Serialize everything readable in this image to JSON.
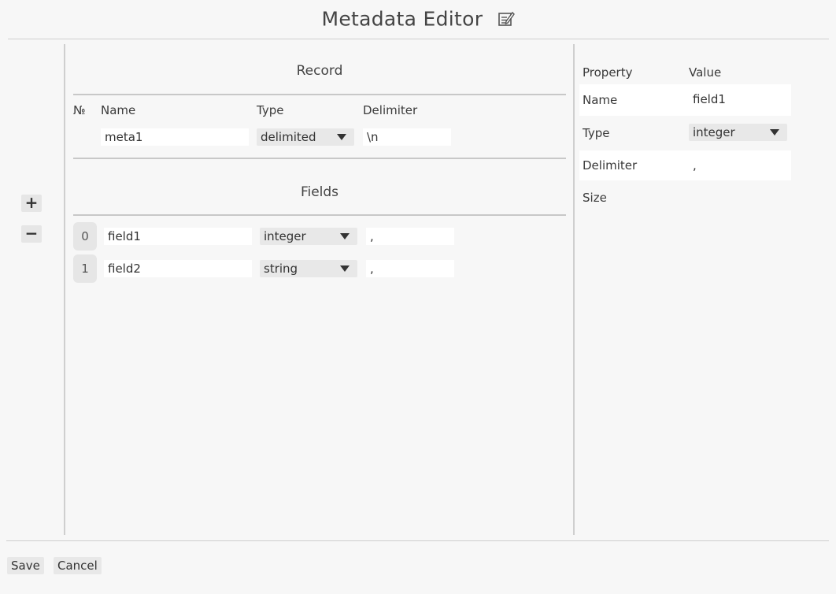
{
  "window": {
    "title": "Metadata Editor",
    "title_icon": "edit-note-icon"
  },
  "sidebar": {
    "add_label": "+",
    "remove_label": "−"
  },
  "record": {
    "section_title": "Record",
    "headers": {
      "number": "№",
      "name": "Name",
      "type": "Type",
      "delimiter": "Delimiter"
    },
    "name": "meta1",
    "type": "delimited",
    "delimiter": "\\n"
  },
  "fields": {
    "section_title": "Fields",
    "rows": [
      {
        "index": "0",
        "name": "field1",
        "type": "integer",
        "delimiter": ","
      },
      {
        "index": "1",
        "name": "field2",
        "type": "string",
        "delimiter": ","
      }
    ]
  },
  "properties": {
    "headers": {
      "property": "Property",
      "value": "Value"
    },
    "rows": [
      {
        "property": "Name",
        "value": "field1"
      },
      {
        "property": "Type",
        "value": "integer"
      },
      {
        "property": "Delimiter",
        "value": ","
      },
      {
        "property": "Size",
        "value": ""
      }
    ]
  },
  "footer": {
    "save_label": "Save",
    "cancel_label": "Cancel"
  },
  "colors": {
    "background": "#f7f7f7",
    "input_bg": "#ffffff",
    "control_bg": "#e8e8e8",
    "divider": "#cfcfcf"
  }
}
